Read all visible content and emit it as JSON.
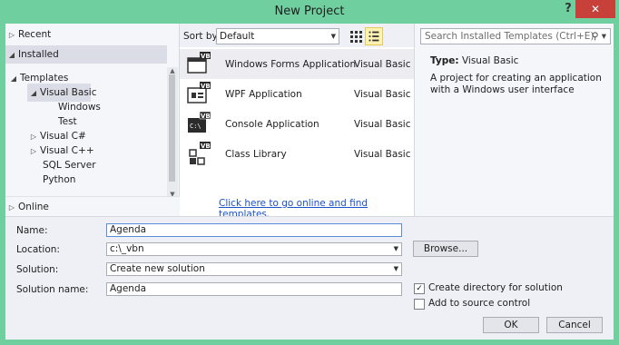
{
  "window": {
    "title": "New Project",
    "help": "?",
    "close": "✕"
  },
  "left": {
    "recent": "Recent",
    "installed": "Installed",
    "templates": "Templates",
    "visual_basic": "Visual Basic",
    "windows": "Windows",
    "test": "Test",
    "visual_csharp": "Visual C#",
    "visual_cpp": "Visual C++",
    "sql_server": "SQL Server",
    "python": "Python",
    "online": "Online"
  },
  "toolbar": {
    "sort_by_label": "Sort by:",
    "sort_value": "Default"
  },
  "templates": [
    {
      "name": "Windows Forms Application",
      "lang": "Visual Basic"
    },
    {
      "name": "WPF Application",
      "lang": "Visual Basic"
    },
    {
      "name": "Console Application",
      "lang": "Visual Basic"
    },
    {
      "name": "Class Library",
      "lang": "Visual Basic"
    }
  ],
  "online_link": "Click here to go online and find templates.",
  "search": {
    "placeholder": "Search Installed Templates (Ctrl+E)"
  },
  "details": {
    "type_label": "Type:",
    "type_value": "Visual Basic",
    "description": "A project for creating an application with a Windows user interface"
  },
  "form": {
    "name_label": "Name:",
    "name_value": "Agenda",
    "location_label": "Location:",
    "location_value": "c:\\_vbn",
    "solution_label": "Solution:",
    "solution_value": "Create new solution",
    "solution_name_label": "Solution name:",
    "solution_name_value": "Agenda",
    "browse": "Browse...",
    "create_dir": "Create directory for solution",
    "create_dir_checked": true,
    "add_source": "Add to source control",
    "add_source_checked": false,
    "ok": "OK",
    "cancel": "Cancel"
  },
  "colors": {
    "title_bar": "#6fcf9f",
    "close": "#c7413a",
    "link": "#1a52c8"
  },
  "icons": {
    "template": "vb-project-icon",
    "search": "search-icon",
    "view_small_icons": "view-grid-icon",
    "view_details": "view-list-icon"
  }
}
